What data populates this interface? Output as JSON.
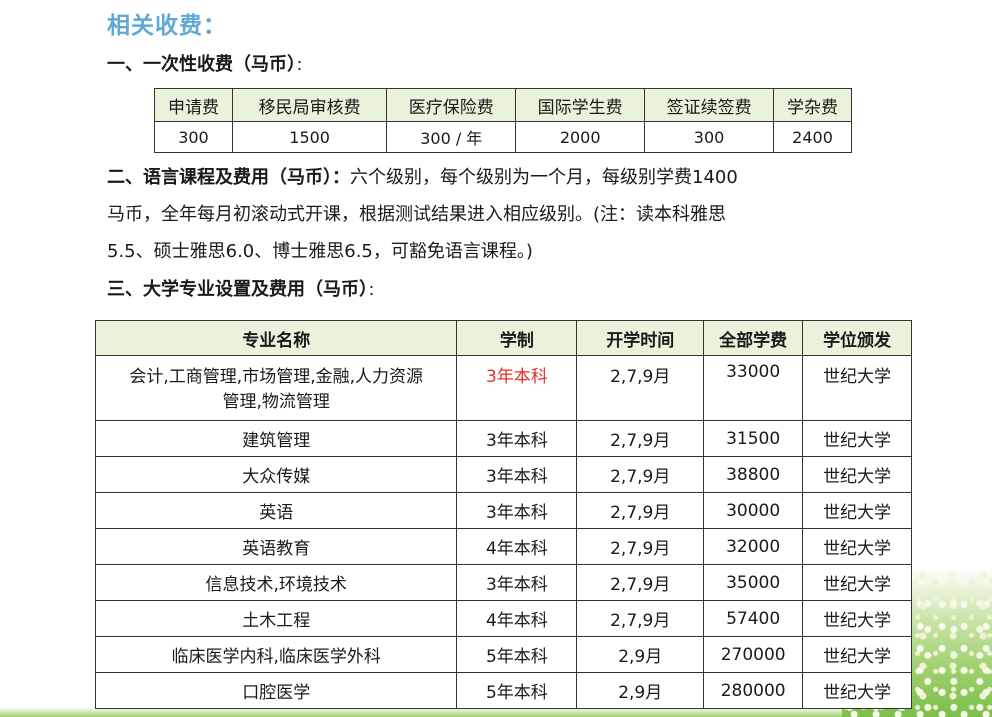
{
  "title": "相关收费：",
  "section1": {
    "heading": "一、一次性收费（马币）",
    "colon": "：",
    "headers": [
      "申请费",
      "移民局审核费",
      "医疗保险费",
      "国际学生费",
      "签证续签费",
      "学杂费"
    ],
    "values": [
      "300",
      "1500",
      "300 / 年",
      "2000",
      "300",
      "2400"
    ]
  },
  "section2": {
    "heading": "二、语言课程及费用（马币）：",
    "text_line1": "六个级别，每个级别为一个月，每级别学费1400",
    "text_line2": "马币，全年每月初滚动式开课，根据测试结果进入相应级别。(注：读本科雅思",
    "text_line3": "5.5、硕士雅思6.0、博士雅思6.5，可豁免语言课程。)"
  },
  "section3": {
    "heading": "三、大学专业设置及费用（马币）",
    "colon": "：",
    "headers": [
      "专业名称",
      "学制",
      "开学时间",
      "全部学费",
      "学位颁发"
    ],
    "rows": [
      {
        "name_line1": "会计,工商管理,市场管理,金融,人力资源",
        "name_line2": "管理,物流管理",
        "duration": "3年本科",
        "intake": "2,7,9月",
        "fee": "33000",
        "degree": "世纪大学"
      },
      {
        "name": "建筑管理",
        "duration": "3年本科",
        "intake": "2,7,9月",
        "fee": "31500",
        "degree": "世纪大学"
      },
      {
        "name": "大众传媒",
        "duration": "3年本科",
        "intake": "2,7,9月",
        "fee": "38800",
        "degree": "世纪大学"
      },
      {
        "name": "英语",
        "duration": "3年本科",
        "intake": "2,7,9月",
        "fee": "30000",
        "degree": "世纪大学"
      },
      {
        "name": "英语教育",
        "duration": "4年本科",
        "intake": "2,7,9月",
        "fee": "32000",
        "degree": "世纪大学"
      },
      {
        "name": "信息技术,环境技术",
        "duration": "3年本科",
        "intake": "2,7,9月",
        "fee": "35000",
        "degree": "世纪大学"
      },
      {
        "name": "土木工程",
        "duration": "4年本科",
        "intake": "2,7,9月",
        "fee": "57400",
        "degree": "世纪大学"
      },
      {
        "name": "临床医学内科,临床医学外科",
        "duration": "5年本科",
        "intake": "2,9月",
        "fee": "270000",
        "degree": "世纪大学"
      },
      {
        "name": "口腔医学",
        "duration": "5年本科",
        "intake": "2,9月",
        "fee": "280000",
        "degree": "世纪大学"
      }
    ]
  },
  "colors": {
    "title": "#5fa9d6",
    "highlight": "#e0312b",
    "header_bg": "#e9f2da"
  }
}
